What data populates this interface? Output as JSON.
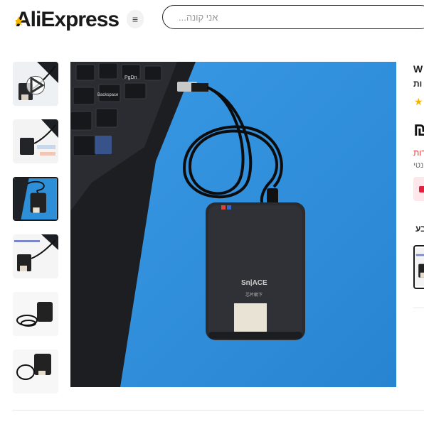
{
  "brand": {
    "name": "AliExpress",
    "accent": "#e62e04",
    "star_color": "#f5b400"
  },
  "header": {
    "menu_icon": "≡",
    "search_placeholder": "אני קונה..."
  },
  "gallery": {
    "thumbnails": [
      {
        "kind": "video",
        "selected": false
      },
      {
        "kind": "image",
        "selected": false
      },
      {
        "kind": "image",
        "selected": true
      },
      {
        "kind": "image",
        "selected": false
      },
      {
        "kind": "image",
        "selected": false
      },
      {
        "kind": "image",
        "selected": false
      }
    ],
    "main_image_background": "#2d8fd8"
  },
  "product": {
    "title_fragment_1": "W",
    "title_fragment_2": "ות",
    "rating_star": "★",
    "price_fragment": "₪",
    "discount_fragment": "דות",
    "subtext_fragment": "נטי",
    "color_label_fragment": "צבע"
  }
}
